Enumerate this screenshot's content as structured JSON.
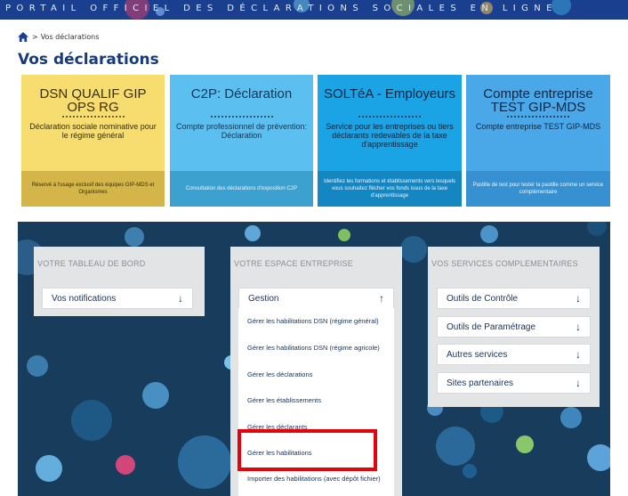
{
  "header": {
    "portal_title": "PORTAIL OFFICIEL DES DÉCLARATIONS SOCIALES EN LIGNE"
  },
  "breadcrumb": {
    "home_icon": "home-icon",
    "separator": ">",
    "current": "Vos déclarations"
  },
  "page": {
    "title": "Vos déclarations"
  },
  "tiles": [
    {
      "title": "DSN QUALIF GIP OPS RG",
      "subtitle": "Déclaration sociale nominative pour le régime général",
      "footer": "Réservé à l'usage exclusif des équipes GIP-MDS et Organismes",
      "color": "#f7dc6f"
    },
    {
      "title": "C2P: Déclaration",
      "subtitle": "Compte professionnel de prévention: Déclaration",
      "footer": "Consultation des déclarations d'exposition C2P",
      "color": "#5bc0f0"
    },
    {
      "title": "SOLTéA - Employeurs",
      "subtitle": "Service pour les entreprises ou tiers déclarants redevables de la taxe d'apprentissage",
      "footer": "Identifiez les formations et établissements vers lesquels vous souhaitez flécher vos fonds issus de la taxe d'apprentissage",
      "color": "#1aa4e6"
    },
    {
      "title": "Compte entreprise TEST GIP-MDS",
      "subtitle": "Compte entreprise TEST GIP-MDS",
      "footer": "Pastille de test pour tester la pastille comme un service complémentaire",
      "color": "#4aa8e8"
    }
  ],
  "panels": {
    "dashboard": {
      "title": "VOTRE TABLEAU DE BORD",
      "items": [
        {
          "label": "Vos notifications",
          "icon": "arrow-down-icon"
        }
      ]
    },
    "enterprise": {
      "title": "VOTRE ESPACE ENTREPRISE",
      "gestion": {
        "label": "Gestion",
        "icon": "arrow-up-icon"
      },
      "menu": [
        "Gérer les habilitations DSN (régime général)",
        "Gérer les habilitations DSN (régime agricole)",
        "Gérer les déclarations",
        "Gérer les établissements",
        "Gérer les déclarants",
        "Gérer les habilitations",
        "Importer des habilitations (avec dépôt fichier)"
      ]
    },
    "services": {
      "title": "VOS SERVICES COMPLEMENTAIRES",
      "items": [
        {
          "label": "Outils de Contrôle",
          "icon": "arrow-down-icon"
        },
        {
          "label": "Outils de Paramétrage",
          "icon": "arrow-down-icon"
        },
        {
          "label": "Autres services",
          "icon": "arrow-down-icon"
        },
        {
          "label": "Sites partenaires",
          "icon": "arrow-down-icon"
        }
      ]
    }
  },
  "colors": {
    "header_bg": "#1b3f8f",
    "title_blue": "#163a7a",
    "band_bg": "#173c5c",
    "highlight": "#e4020c"
  }
}
